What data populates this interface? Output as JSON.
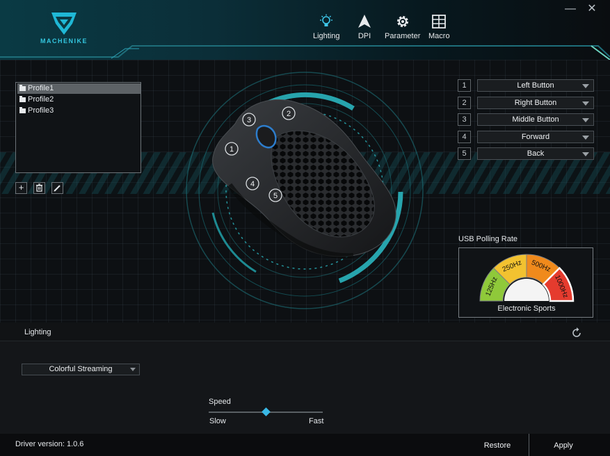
{
  "app": {
    "brand": "MACHENIKE"
  },
  "window": {
    "minimize": "—",
    "close": "✕"
  },
  "nav": [
    {
      "label": "Lighting",
      "icon": "lightbulb-icon",
      "active": true
    },
    {
      "label": "DPI",
      "icon": "pointer-arrow-icon",
      "active": false
    },
    {
      "label": "Parameter",
      "icon": "gear-icon",
      "active": false
    },
    {
      "label": "Macro",
      "icon": "grid-icon",
      "active": false
    }
  ],
  "profiles": {
    "items": [
      "Profile1",
      "Profile2",
      "Profile3"
    ],
    "selected": "Profile1",
    "actions": [
      {
        "name": "add",
        "icon": "plus-icon",
        "glyph": "+"
      },
      {
        "name": "delete",
        "icon": "trash-icon",
        "glyph": ""
      },
      {
        "name": "edit",
        "icon": "pencil-icon",
        "glyph": ""
      }
    ]
  },
  "mouse_markers": [
    "1",
    "2",
    "3",
    "4",
    "5"
  ],
  "buttons": [
    {
      "num": "1",
      "assignment": "Left Button"
    },
    {
      "num": "2",
      "assignment": "Right Button"
    },
    {
      "num": "3",
      "assignment": "Middle Button"
    },
    {
      "num": "4",
      "assignment": "Forward"
    },
    {
      "num": "5",
      "assignment": "Back"
    }
  ],
  "polling": {
    "title": "USB Polling Rate",
    "rates": [
      "125Hz",
      "250Hz",
      "500Hz",
      "1000Hz"
    ],
    "selected": "1000Hz",
    "caption": "Electronic Sports",
    "colors": [
      "#8fc93a",
      "#f2c230",
      "#f08a1c",
      "#e53b2e"
    ]
  },
  "lighting": {
    "title": "Lighting",
    "mode": "Colorful Streaming",
    "speed_label": "Speed",
    "slow_label": "Slow",
    "fast_label": "Fast",
    "speed_fraction": 0.5,
    "accent": "#39b8e6"
  },
  "footer": {
    "driver": "Driver version: 1.0.6",
    "restore": "Restore",
    "apply": "Apply"
  }
}
